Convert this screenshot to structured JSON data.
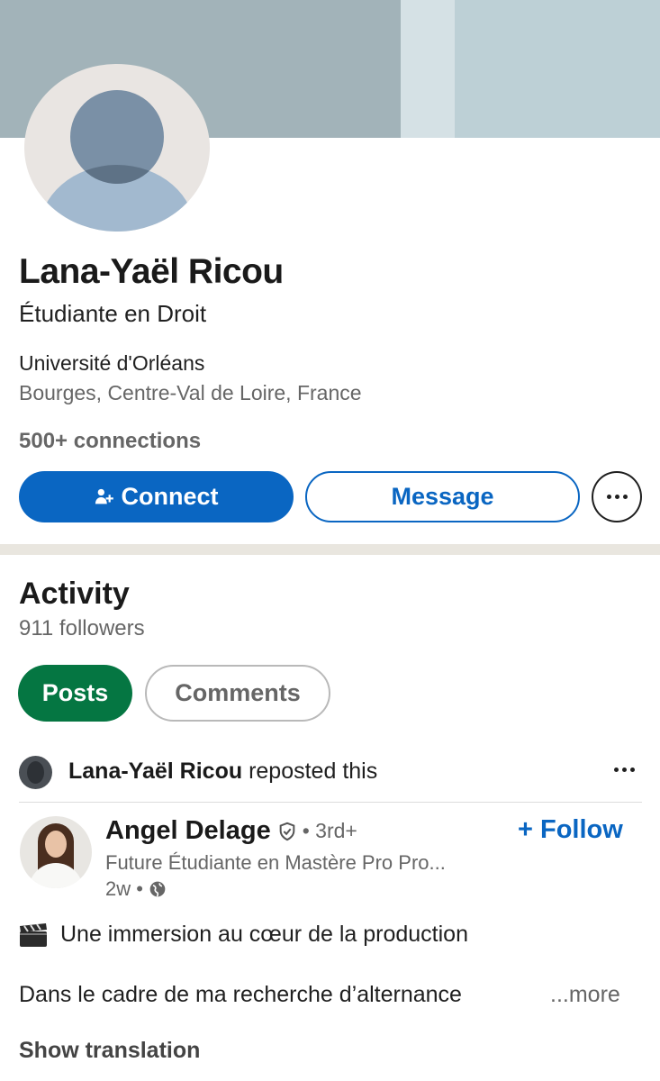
{
  "profile": {
    "name": "Lana-Yaël Ricou",
    "headline": "Étudiante en Droit",
    "school": "Université d'Orléans",
    "location": "Bourges, Centre-Val de Loire, France",
    "connections": "500+ connections"
  },
  "actions": {
    "connect_label": "Connect",
    "message_label": "Message"
  },
  "activity": {
    "title": "Activity",
    "followers": "911 followers",
    "tabs": [
      {
        "label": "Posts",
        "selected": true
      },
      {
        "label": "Comments",
        "selected": false
      }
    ]
  },
  "repost": {
    "reposter": "Lana-Yaël Ricou",
    "text": "reposted this"
  },
  "post": {
    "author": "Angel Delage",
    "degree": "• 3rd+",
    "follow_label": "+ Follow",
    "author_subtitle": "Future Étudiante en Mastère Pro Pro...",
    "time": "2w •",
    "line1": "Une immersion au cœur de la production",
    "line2": "Dans le cadre de ma recherche d’alternance",
    "more_label": "...more",
    "translation_label": "Show translation"
  },
  "colors": {
    "accent": "#0a66c2",
    "posts_tab": "#057642",
    "banner": "#a2b3b9"
  },
  "icons": [
    "add-person-icon",
    "more-icon",
    "verified-shield-icon",
    "globe-icon",
    "clapperboard-icon"
  ]
}
